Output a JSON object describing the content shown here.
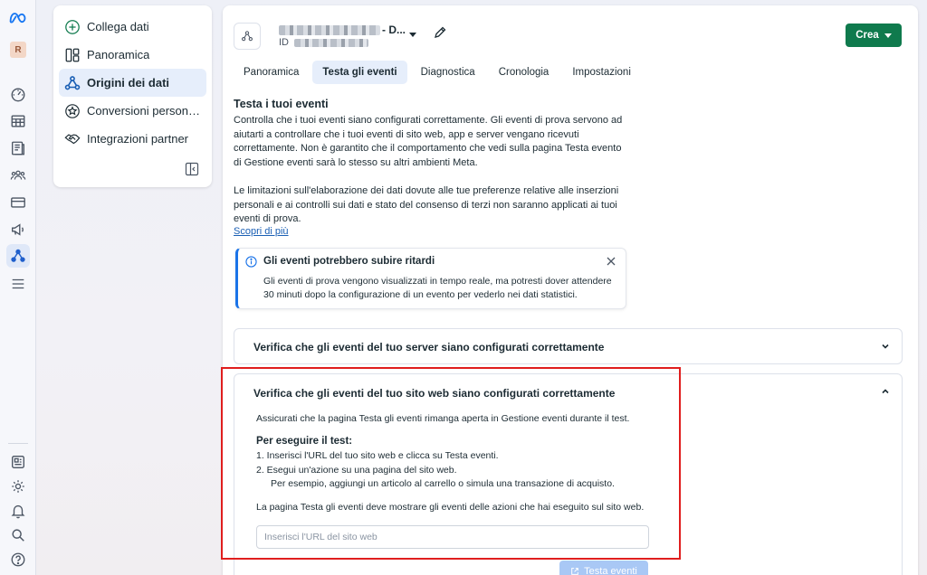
{
  "rail": {
    "avatar": "R",
    "top_icons": [
      "dashboard-icon",
      "table-icon",
      "pages-icon",
      "audience-icon",
      "billing-icon",
      "ads-icon",
      "events-manager-icon",
      "menu-icon"
    ],
    "bottom_icons": [
      "news-icon",
      "settings-icon",
      "bell-icon",
      "search-icon",
      "help-icon"
    ]
  },
  "subnav": {
    "items": [
      {
        "label": "Collega dati",
        "icon": "plus-circle-icon"
      },
      {
        "label": "Panoramica",
        "icon": "layout-icon"
      },
      {
        "label": "Origini dei dati",
        "icon": "data-sources-icon",
        "active": true
      },
      {
        "label": "Conversioni person…",
        "icon": "star-badge-icon"
      },
      {
        "label": "Integrazioni partner",
        "icon": "handshake-icon"
      }
    ]
  },
  "header": {
    "name_suffix": "- D...",
    "id_label": "ID",
    "create_label": "Crea"
  },
  "tabs": [
    {
      "label": "Panoramica"
    },
    {
      "label": "Testa gli eventi",
      "active": true
    },
    {
      "label": "Diagnostica"
    },
    {
      "label": "Cronologia"
    },
    {
      "label": "Impostazioni"
    }
  ],
  "content": {
    "title": "Testa i tuoi eventi",
    "para1": "Controlla che i tuoi eventi siano configurati correttamente. Gli eventi di prova servono ad aiutarti a controllare che i tuoi eventi di sito web, app e server vengano ricevuti correttamente. Non è garantito che il comportamento che vedi sulla pagina Testa evento di Gestione eventi sarà lo stesso su altri ambienti Meta.",
    "para2": "Le limitazioni sull'elaborazione dei dati dovute alle tue preferenze relative alle inserzioni personali e ai controlli sui dati e stato del consenso di terzi non saranno applicati ai tuoi eventi di prova.",
    "learn_more": "Scopri di più",
    "notice": {
      "title": "Gli eventi potrebbero subire ritardi",
      "body": "Gli eventi di prova vengono visualizzati in tempo reale, ma potresti dover attendere 30 minuti dopo la configurazione di un evento per vederlo nei dati statistici."
    },
    "server_section": {
      "title": "Verifica che gli eventi del tuo server siano configurati correttamente"
    },
    "web_section": {
      "title": "Verifica che gli eventi del tuo sito web siano configurati correttamente",
      "intro": "Assicurati che la pagina Testa gli eventi rimanga aperta in Gestione eventi durante il test.",
      "steps_title": "Per eseguire il test:",
      "step1": "1.  Inserisci l'URL del tuo sito web e clicca su Testa eventi.",
      "step2": "2.  Esegui un'azione su una pagina del sito web.",
      "step2_note": "Per esempio, aggiungi un articolo al carrello o simula una transazione di acquisto.",
      "outro": "La pagina Testa gli eventi deve mostrare gli eventi delle azioni che hai eseguito sul sito web.",
      "url_placeholder": "Inserisci l'URL del sito web",
      "test_button": "Testa eventi"
    }
  },
  "colors": {
    "primary_green": "#0f7a4d",
    "accent_blue": "#1a73e8",
    "highlight_red": "#e01e1e",
    "active_bg": "#e6eefb"
  }
}
